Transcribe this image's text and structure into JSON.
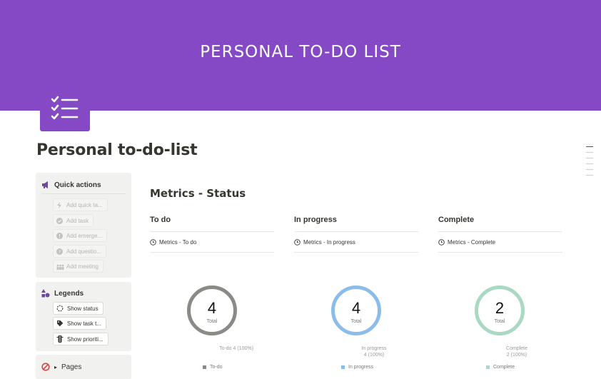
{
  "banner": {
    "title": "PERSONAL TO-DO LIST",
    "color": "#8549c5"
  },
  "page": {
    "title": "Personal to-do-list",
    "icon": "checklist-icon"
  },
  "sidebar": {
    "quick_actions": {
      "title": "Quick actions",
      "icon": "megaphone-icon",
      "buttons": [
        {
          "label": "Add quick ta...",
          "icon": "lightning-icon"
        },
        {
          "label": "Add task",
          "icon": "check-circle-icon"
        },
        {
          "label": "Add emerge...",
          "icon": "alert-circle-icon"
        },
        {
          "label": "Add questio...",
          "icon": "question-circle-icon"
        },
        {
          "label": "Add meeting",
          "icon": "people-icon"
        }
      ]
    },
    "legends": {
      "title": "Legends",
      "icon": "shapes-icon",
      "buttons": [
        {
          "label": "Show status",
          "icon": "loading-circle-icon"
        },
        {
          "label": "Show task t...",
          "icon": "tag-icon"
        },
        {
          "label": "Show prioriti...",
          "icon": "traffic-light-icon"
        }
      ]
    },
    "pages": {
      "title": "Pages",
      "icon": "prohibited-icon",
      "toggle": "▸"
    }
  },
  "metrics": {
    "title": "Metrics - Status",
    "columns": [
      {
        "heading": "To do",
        "view": "Metrics - To do",
        "total": "4",
        "total_label": "Total",
        "note_lines": [
          "To-do  4 (100%)"
        ],
        "legend": "To-do",
        "color": "#8b8a86"
      },
      {
        "heading": "In progress",
        "view": "Metrics - In progress",
        "total": "4",
        "total_label": "Total",
        "note_lines": [
          "In progress",
          "4 (100%)"
        ],
        "legend": "In progress",
        "color": "#8cbce8"
      },
      {
        "heading": "Complete",
        "view": "Metrics - Complete",
        "total": "2",
        "total_label": "Total",
        "note_lines": [
          "Complete",
          "2 (100%)"
        ],
        "legend": "Complete",
        "color": "#a9d9c2"
      }
    ]
  }
}
